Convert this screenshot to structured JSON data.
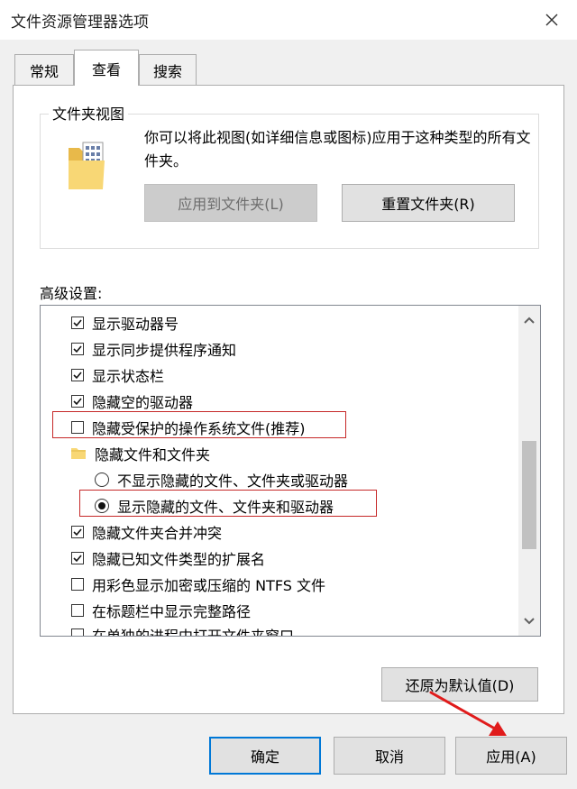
{
  "window": {
    "title": "文件资源管理器选项"
  },
  "tabs": [
    {
      "label": "常规",
      "active": false
    },
    {
      "label": "查看",
      "active": true
    },
    {
      "label": "搜索",
      "active": false
    }
  ],
  "folder_views": {
    "legend": "文件夹视图",
    "description": "你可以将此视图(如详细信息或图标)应用于这种类型的所有文件夹。",
    "apply_button": "应用到文件夹(L)",
    "reset_button": "重置文件夹(R)"
  },
  "advanced": {
    "label": "高级设置:",
    "items": [
      {
        "type": "checkbox",
        "checked": true,
        "label": "显示驱动器号"
      },
      {
        "type": "checkbox",
        "checked": true,
        "label": "显示同步提供程序通知"
      },
      {
        "type": "checkbox",
        "checked": true,
        "label": "显示状态栏"
      },
      {
        "type": "checkbox",
        "checked": true,
        "label": "隐藏空的驱动器"
      },
      {
        "type": "checkbox",
        "checked": false,
        "label": "隐藏受保护的操作系统文件(推荐)"
      },
      {
        "type": "folder",
        "label": "隐藏文件和文件夹"
      },
      {
        "type": "radio",
        "checked": false,
        "label": "不显示隐藏的文件、文件夹或驱动器"
      },
      {
        "type": "radio",
        "checked": true,
        "label": "显示隐藏的文件、文件夹和驱动器"
      },
      {
        "type": "checkbox",
        "checked": true,
        "label": "隐藏文件夹合并冲突"
      },
      {
        "type": "checkbox",
        "checked": true,
        "label": "隐藏已知文件类型的扩展名"
      },
      {
        "type": "checkbox",
        "checked": false,
        "label": "用彩色显示加密或压缩的 NTFS 文件"
      },
      {
        "type": "checkbox",
        "checked": false,
        "label": "在标题栏中显示完整路径"
      },
      {
        "type": "checkbox",
        "checked": false,
        "label": "在单独的进程中打开文件夹窗口"
      }
    ],
    "restore_button": "还原为默认值(D)"
  },
  "footer": {
    "ok": "确定",
    "cancel": "取消",
    "apply": "应用(A)"
  },
  "icons": {
    "close": "close-icon",
    "folder": "folder-view-icon",
    "tree_folder": "folder-icon",
    "checkmark": "checkmark-icon",
    "scroll_up": "chevron-up-icon",
    "scroll_down": "chevron-down-icon"
  },
  "colors": {
    "accent": "#0078d7",
    "highlight": "#c62828",
    "annotation_arrow": "#e01b1b",
    "folder": "#f8d775"
  }
}
